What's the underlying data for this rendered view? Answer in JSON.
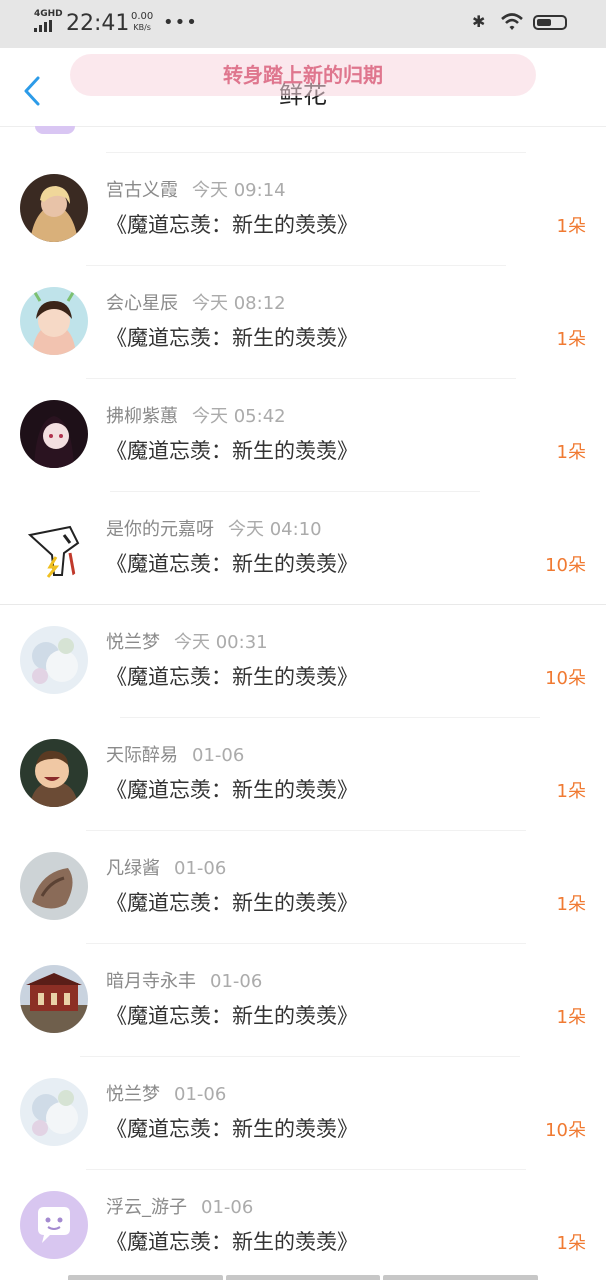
{
  "status_bar": {
    "network": "4GHD",
    "time": "22:41",
    "speed": "0.00",
    "speed_unit": "KB/s",
    "more": "•••",
    "bluetooth_icon": "bluetooth-icon",
    "wifi_icon": "wifi-icon",
    "battery_icon": "battery-icon"
  },
  "header": {
    "back_icon": "chevron-left-icon",
    "title": "鲜花",
    "toast": "转身踏上新的归期"
  },
  "colors": {
    "accent": "#f07a32",
    "back": "#2c9be8",
    "name": "#8a8a8a",
    "title": "#333333"
  },
  "rows": [
    {
      "name": "宫古义霞",
      "time": "今天 09:14",
      "book": "《魔道忘羡：新生的羡羡》",
      "flowers": "1朵"
    },
    {
      "name": "会心星辰",
      "time": "今天 08:12",
      "book": "《魔道忘羡：新生的羡羡》",
      "flowers": "1朵"
    },
    {
      "name": "拂柳紫蕙",
      "time": "今天 05:42",
      "book": "《魔道忘羡：新生的羡羡》",
      "flowers": "1朵"
    },
    {
      "name": "是你的元嘉呀",
      "time": "今天 04:10",
      "book": "《魔道忘羡：新生的羡羡》",
      "flowers": "10朵"
    },
    {
      "name": "悦兰梦",
      "time": "今天 00:31",
      "book": "《魔道忘羡：新生的羡羡》",
      "flowers": "10朵"
    },
    {
      "name": "天际醉易",
      "time": "01-06",
      "book": "《魔道忘羡：新生的羡羡》",
      "flowers": "1朵"
    },
    {
      "name": "凡绿酱",
      "time": "01-06",
      "book": "《魔道忘羡：新生的羡羡》",
      "flowers": "1朵"
    },
    {
      "name": "暗月寺永丰",
      "time": "01-06",
      "book": "《魔道忘羡：新生的羡羡》",
      "flowers": "1朵"
    },
    {
      "name": "悦兰梦",
      "time": "01-06",
      "book": "《魔道忘羡：新生的羡羡》",
      "flowers": "10朵"
    },
    {
      "name": "浮云_游子",
      "time": "01-06",
      "book": "《魔道忘羡：新生的羡羡》",
      "flowers": "1朵"
    }
  ]
}
